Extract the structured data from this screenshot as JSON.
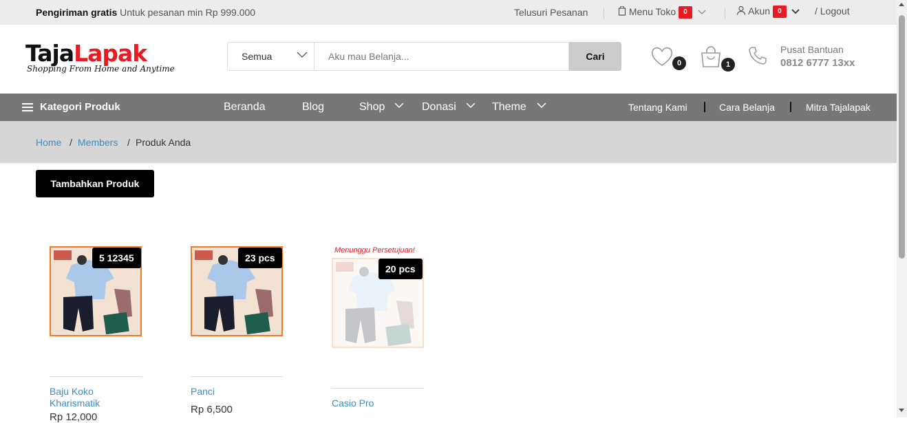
{
  "topbar": {
    "promo_bold": "Pengiriman gratis",
    "promo_text": "Untuk pesanan min Rp 999.000",
    "track_order": "Telusuri Pesanan",
    "store_menu": "Menu Toko",
    "store_badge": "0",
    "account": "Akun",
    "account_badge": "0",
    "logout": "/ Logout"
  },
  "header": {
    "logo_part1": "Taja",
    "logo_part2": "Lapak",
    "logo_tagline": "Shopping From Home and Anytime",
    "search_category": "Semua",
    "search_placeholder": "Aku mau Belanja...",
    "search_button": "Cari",
    "wishlist_count": "0",
    "cart_count": "1",
    "help_label": "Pusat Bantuan",
    "help_phone": "0812 6777 13xx"
  },
  "nav": {
    "category_label": "Kategori Produk",
    "menu": [
      "Beranda",
      "Blog",
      "Shop",
      "Donasi",
      "Theme"
    ],
    "links": [
      "Tentang Kami",
      "Cara Belanja",
      "Mitra Tajalapak"
    ]
  },
  "breadcrumb": {
    "home": "Home",
    "members": "Members",
    "current": "Produk Anda"
  },
  "add_product_label": "Tambahkan Produk",
  "products": [
    {
      "name": "Baju Koko Kharismatik",
      "stock": "5 12345",
      "price": "Rp 12,000",
      "status": ""
    },
    {
      "name": "Panci",
      "stock": "23 pcs",
      "price": "Rp 6,500",
      "status": ""
    },
    {
      "name": "Casio Pro",
      "stock": "20 pcs",
      "price": "",
      "status": "Menunggu Persetujuan!"
    }
  ],
  "colors": {
    "brand_red": "#e61b23",
    "nav_bg": "#777777",
    "link_blue": "#3b8bc4",
    "card_border": "#f07a28"
  }
}
